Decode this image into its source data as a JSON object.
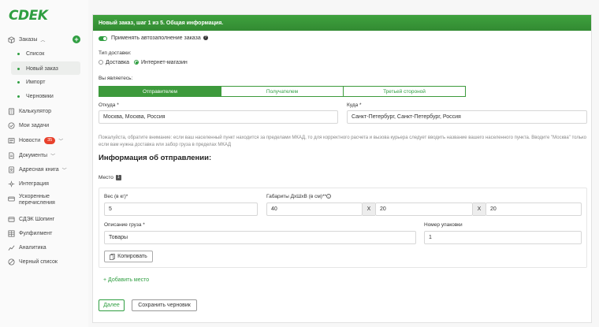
{
  "brand": {
    "logo": "СDEK",
    "accent": "#2f9e41"
  },
  "sidebar": {
    "orders": {
      "label": "Заказы",
      "icon": "box-icon"
    },
    "sub_items": [
      "Список",
      "Новый заказ",
      "Импорт",
      "Черновики"
    ],
    "items": [
      {
        "label": "Калькулятор",
        "icon": "calculator-icon"
      },
      {
        "label": "Мои задачи",
        "icon": "check-circle-icon"
      },
      {
        "label": "Новости",
        "icon": "news-icon",
        "badge": "35"
      },
      {
        "label": "Документы",
        "icon": "document-icon"
      },
      {
        "label": "Адресная книга",
        "icon": "address-book-icon"
      },
      {
        "label": "Интеграция",
        "icon": "integration-icon"
      },
      {
        "label": "Ускоренные перечисления",
        "icon": "payment-icon"
      },
      {
        "label": "СДЭК Шопинг",
        "icon": "shopping-icon"
      },
      {
        "label": "Фулфилмент",
        "icon": "warehouse-icon"
      },
      {
        "label": "Аналитика",
        "icon": "chart-icon"
      },
      {
        "label": "Черный список",
        "icon": "block-icon"
      }
    ]
  },
  "panel": {
    "header": "Новый заказ, шаг 1 из 5. Общая информация.",
    "autofill_label": "Применять автозаполнение заказа",
    "delivery_type_label": "Тип доставки:",
    "delivery_options": [
      "Доставка",
      "Интернет-магазин"
    ],
    "role_label": "Вы являетесь:",
    "roles": [
      "Отправителем",
      "Получателем",
      "Третьей стороной"
    ],
    "from_label": "Откуда *",
    "from_value": "Москва, Москва, Россия",
    "to_label": "Куда *",
    "to_value": "Санкт-Петербург, Санкт-Петербург, Россия",
    "note": "Пожалуйста, обратите внимание: если ваш населенный пункт находится за пределами МКАД, то для корректного расчета и вызова курьера следует вводить название вашего населенного пункта. Вводите \"Москва\" только если вам нужна доставка или забор груза в пределах МКАД",
    "sender_info_title": "Информация об отправлении:",
    "place_label": "Место",
    "place_number": "1",
    "weight_label": "Вес (в кг)*",
    "weight_value": "5",
    "dims_label": "Габариты ДхШхВ (в см)**",
    "dims": [
      "40",
      "20",
      "20"
    ],
    "dims_separator": "X",
    "cargo_desc_label": "Описание груза *",
    "cargo_desc_value": "Товары",
    "package_no_label": "Номер упаковки",
    "package_no_value": "1",
    "copy_button": "Копировать",
    "add_place": "+ Добавить место",
    "next_button": "Далее",
    "save_draft_button": "Сохранить черновик"
  }
}
